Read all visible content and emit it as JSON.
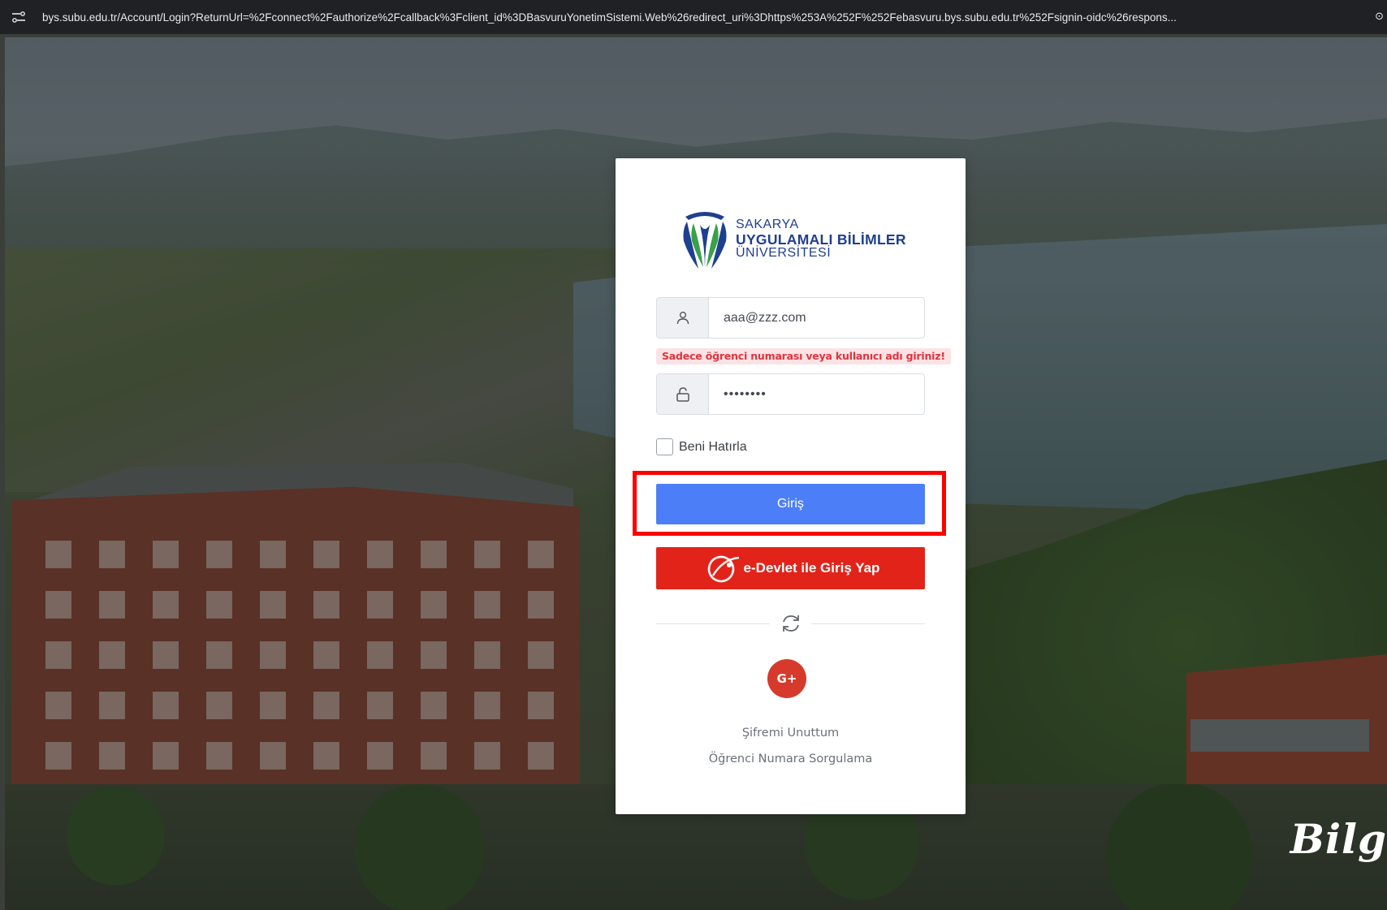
{
  "browser": {
    "url": "bys.subu.edu.tr/Account/Login?ReturnUrl=%2Fconnect%2Fauthorize%2Fcallback%3Fclient_id%3DBasvuruYonetimSistemi.Web%26redirect_uri%3Dhttps%253A%252F%252Febasvuru.bys.subu.edu.tr%252Fsignin-oidc%26respons..."
  },
  "background": {
    "script_text": "Bilg"
  },
  "logo": {
    "line1": "SAKARYA",
    "line2": "UYGULAMALI BİLİMLER",
    "line3": "ÜNİVERSİTESİ",
    "colors": {
      "blue": "#1f3f8f",
      "green": "#3aa04a"
    }
  },
  "form": {
    "username": {
      "value": "aaa@zzz.com",
      "icon": "user-icon"
    },
    "username_error": "Sadece öğrenci numarası veya kullanıcı adı giriniz!",
    "password": {
      "value": "••••••••",
      "icon": "lock-icon"
    },
    "remember_label": "Beni Hatırla",
    "login_button": "Giriş",
    "edevlet_button": "e-Devlet ile Giriş Yap",
    "refresh_icon": "refresh-icon",
    "google_button": "G+"
  },
  "links": {
    "forgot_password": "Şifremi Unuttum",
    "student_number_query": "Öğrenci Numara Sorgulama"
  },
  "colors": {
    "login_button": "#4c7ff7",
    "edevlet_button": "#e2231a",
    "google_button": "#d63a2c",
    "error_text": "#e0343f",
    "highlight": "#ff0000"
  }
}
